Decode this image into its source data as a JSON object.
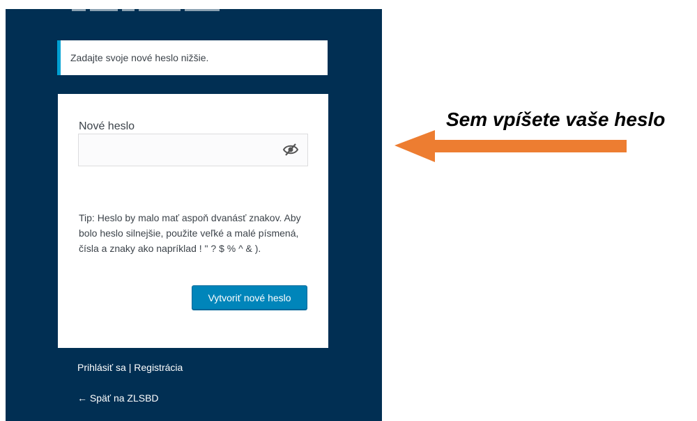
{
  "notice": {
    "text": "Zadajte svoje nové heslo nižšie."
  },
  "form": {
    "password_label": "Nové heslo",
    "password_value": "",
    "tip": "Tip: Heslo by malo mať aspoň dvanásť znakov. Aby bolo heslo silnejšie, použite veľké a malé písmená, čísla a znaky ako napríklad ! \" ? $ % ^ & ).",
    "submit_label": "Vytvoriť nové heslo",
    "visibility_icon": "eye-slash-icon"
  },
  "nav": {
    "login_label": "Prihlásiť sa",
    "separator": "|",
    "register_label": "Registrácia",
    "back_label": "← Späť na ZLSBD"
  },
  "annotation": {
    "text": "Sem vpíšete vaše heslo",
    "arrow_color": "#ed7d31"
  },
  "colors": {
    "panel_bg": "#012f53",
    "notice_accent": "#00a0d2",
    "button_bg": "#0085ba"
  }
}
